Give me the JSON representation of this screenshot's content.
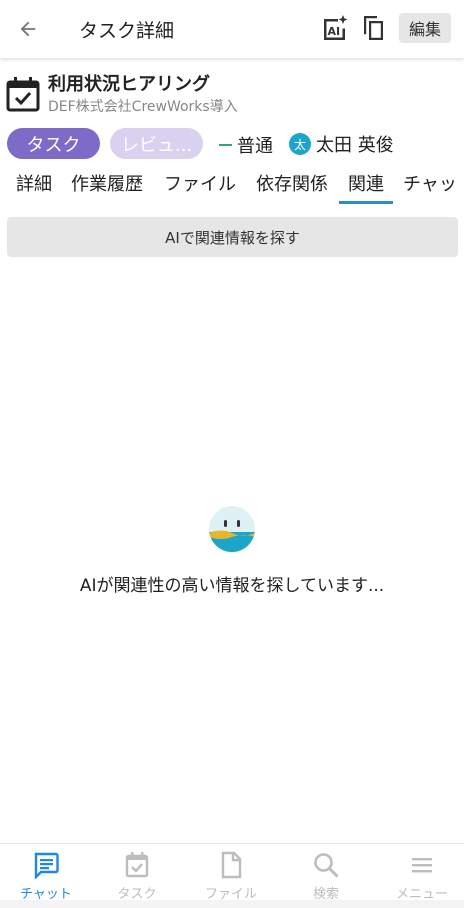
{
  "header": {
    "title": "タスク詳細",
    "edit_label": "編集",
    "icons": {
      "back": "arrow-left-icon",
      "ai": "ai-sparkle-icon",
      "copy": "copy-icon"
    }
  },
  "task": {
    "title": "利用状況ヒアリング",
    "subtitle": "DEF株式会社CrewWorks導入",
    "type_chip": "タスク",
    "status_chip": "レビュ...",
    "priority": "普通",
    "assignee_initial": "太",
    "assignee": "太田 英俊"
  },
  "tabs": [
    {
      "label": "詳細"
    },
    {
      "label": "作業履歴"
    },
    {
      "label": "ファイル"
    },
    {
      "label": "依存関係"
    },
    {
      "label": "関連"
    },
    {
      "label": "チャッ"
    }
  ],
  "active_tab": "関連",
  "ai_search_button": "AIで関連情報を探す",
  "loading_message": "AIが関連性の高い情報を探しています...",
  "bottom_nav": [
    {
      "label": "チャット",
      "icon": "chat-icon",
      "active": true
    },
    {
      "label": "タスク",
      "icon": "task-icon",
      "active": false
    },
    {
      "label": "ファイル",
      "icon": "file-icon",
      "active": false
    },
    {
      "label": "検索",
      "icon": "search-icon",
      "active": false
    },
    {
      "label": "メニュー",
      "icon": "menu-icon",
      "active": false
    }
  ],
  "colors": {
    "accent_blue": "#1e88e5",
    "type_chip": "#7c6bc7",
    "status_chip": "#d9d1f0",
    "priority_dash": "#33a37f",
    "avatar": "#1aa5c9",
    "tab_underline": "#2a8fc7"
  }
}
